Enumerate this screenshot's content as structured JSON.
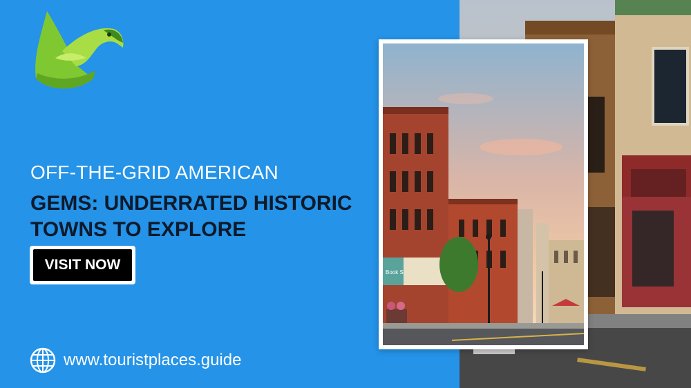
{
  "brand": {
    "logo_icon": "green-eagle-logo-icon",
    "colors": {
      "background_blue": "#2493e8",
      "logo_green": "#8fd13a",
      "headline_dark": "#0d1a2b",
      "button_black": "#000000"
    }
  },
  "headline": {
    "line1": "OFF-THE-GRID AMERICAN",
    "line2": "GEMS: UNDERRATED HISTORIC TOWNS TO EXPLORE"
  },
  "cta": {
    "label": "VISIT NOW"
  },
  "footer": {
    "icon": "globe-icon",
    "url": "www.touristplaces.guide"
  },
  "photos": {
    "inset": "historic-main-street-sunset-photo",
    "background": "historic-building-facade-photo",
    "inset_signage": "Book Shop"
  }
}
